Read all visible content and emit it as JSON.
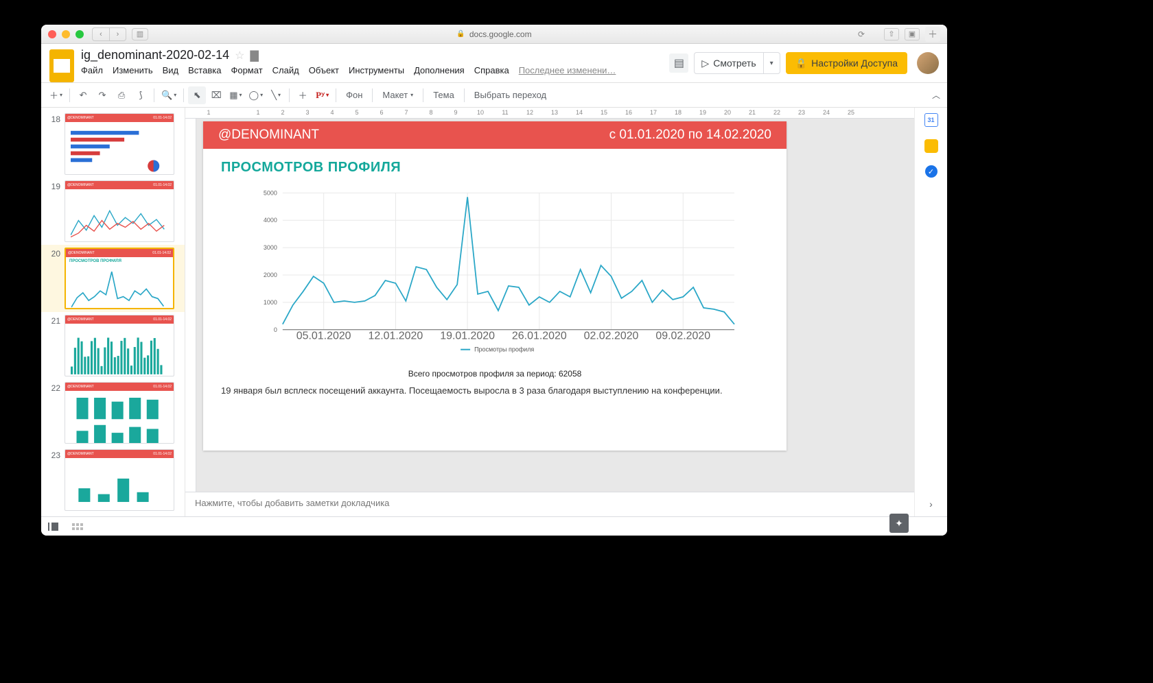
{
  "browser": {
    "url": "docs.google.com"
  },
  "doc": {
    "title": "ig_denominant-2020-02-14",
    "menus": [
      "Файл",
      "Изменить",
      "Вид",
      "Вставка",
      "Формат",
      "Слайд",
      "Объект",
      "Инструменты",
      "Дополнения",
      "Справка"
    ],
    "last_edit": "Последнее изменени…",
    "present_label": "Смотреть",
    "share_label": "Настройки Доступа"
  },
  "toolbar": {
    "bg_label": "Фон",
    "layout_label": "Макет",
    "theme_label": "Тема",
    "transition_label": "Выбрать переход"
  },
  "ruler": {
    "ticks": [
      "1",
      "",
      "1",
      "2",
      "3",
      "4",
      "5",
      "6",
      "7",
      "8",
      "9",
      "10",
      "11",
      "12",
      "13",
      "14",
      "15",
      "16",
      "17",
      "18",
      "19",
      "20",
      "21",
      "22",
      "23",
      "24",
      "25"
    ]
  },
  "thumbs": [
    {
      "num": "18",
      "title": "",
      "type": "bars-h"
    },
    {
      "num": "19",
      "title": "",
      "type": "line-multi"
    },
    {
      "num": "20",
      "title": "ПРОСМОТРОВ ПРОФИЛЯ",
      "type": "line-single",
      "active": true
    },
    {
      "num": "21",
      "title": "",
      "type": "bars-dense"
    },
    {
      "num": "22",
      "title": "",
      "type": "bars-grouped"
    },
    {
      "num": "23",
      "title": "",
      "type": "bars-sparse"
    }
  ],
  "slide": {
    "handle": "@DENOMINANT",
    "period": "с 01.01.2020 по 14.02.2020",
    "section_title": "ПРОСМОТРОВ ПРОФИЛЯ",
    "legend": "Просмотры профиля",
    "total_line": "Всего просмотров профиля за период: 62058",
    "note": "19 января был всплеск посещений аккаунта. Посещаемость выросла в 3 раза благодаря выступлению на конференции."
  },
  "speaker_notes_placeholder": "Нажмите, чтобы добавить заметки докладчика",
  "sidepanel": {
    "calendar_day": "31"
  },
  "chart_data": {
    "type": "line",
    "title": "ПРОСМОТРОВ ПРОФИЛЯ",
    "xlabel": "",
    "ylabel": "",
    "ylim": [
      0,
      5000
    ],
    "y_ticks": [
      0,
      1000,
      2000,
      3000,
      4000,
      5000
    ],
    "x_tick_labels": [
      "05.01.2020",
      "12.01.2020",
      "19.01.2020",
      "26.01.2020",
      "02.02.2020",
      "09.02.2020"
    ],
    "series": [
      {
        "name": "Просмотры профиля",
        "color": "#2aa7c7",
        "values": [
          200,
          900,
          1400,
          1950,
          1700,
          1000,
          1050,
          1000,
          1050,
          1250,
          1800,
          1700,
          1050,
          2300,
          2200,
          1550,
          1100,
          1650,
          4850,
          1300,
          1400,
          700,
          1600,
          1550,
          900,
          1200,
          1000,
          1400,
          1200,
          2200,
          1350,
          2350,
          1950,
          1150,
          1400,
          1800,
          1000,
          1450,
          1100,
          1200,
          1550,
          800,
          750,
          650,
          200
        ]
      }
    ],
    "total": 62058
  }
}
